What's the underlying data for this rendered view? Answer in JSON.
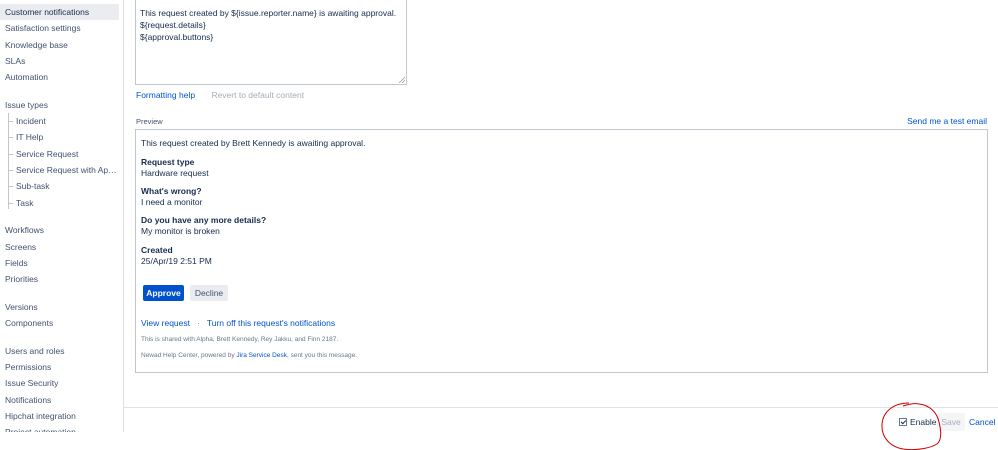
{
  "sidebar": {
    "group1": [
      "Customer notifications",
      "Satisfaction settings",
      "Knowledge base",
      "SLAs",
      "Automation"
    ],
    "issue_types_header": "Issue types",
    "issue_types": [
      "Incident",
      "IT Help",
      "Service Request",
      "Service Request with Approvals",
      "Sub-task",
      "Task"
    ],
    "group2": [
      "Workflows",
      "Screens",
      "Fields",
      "Priorities"
    ],
    "group3": [
      "Versions",
      "Components"
    ],
    "group4": [
      "Users and roles",
      "Permissions",
      "Issue Security",
      "Notifications",
      "Hipchat integration",
      "Project automation"
    ]
  },
  "template": {
    "lines": [
      "This request created by ${issue.reporter.name} is awaiting approval.",
      "${request.details}",
      "${approval.buttons}"
    ],
    "formatting_help": "Formatting help",
    "revert": "Revert to default content"
  },
  "preview": {
    "label": "Preview",
    "send_test_email": "Send me a test email",
    "intro": "This request created by Brett Kennedy is awaiting approval.",
    "fields": [
      {
        "label": "Request type",
        "value": "Hardware request"
      },
      {
        "label": "What's wrong?",
        "value": "I need a monitor"
      },
      {
        "label": "Do you have any more details?",
        "value": "My monitor is broken"
      },
      {
        "label": "Created",
        "value": "25/Apr/19 2:51 PM"
      }
    ],
    "approve": "Approve",
    "decline": "Decline",
    "view_request": "View request",
    "separator": "·",
    "turn_off": "Turn off this request's notifications",
    "shared_with": "This is shared with Alpha, Brett Kennedy, Rey Jakku, and Finn 2187.",
    "powered_prefix": "Newad Help Center, powered by ",
    "powered_link": "Jira Service Desk",
    "powered_suffix": ", sent you this message."
  },
  "footer": {
    "enable": "Enable",
    "enable_checked": true,
    "save": "Save",
    "cancel": "Cancel"
  },
  "colors": {
    "link": "#0052cc",
    "primary": "#0052cc",
    "annotation": "#cc0000"
  },
  "icons": {
    "resize": "resize-grip-icon",
    "annotation": "hand-drawn-circle"
  }
}
